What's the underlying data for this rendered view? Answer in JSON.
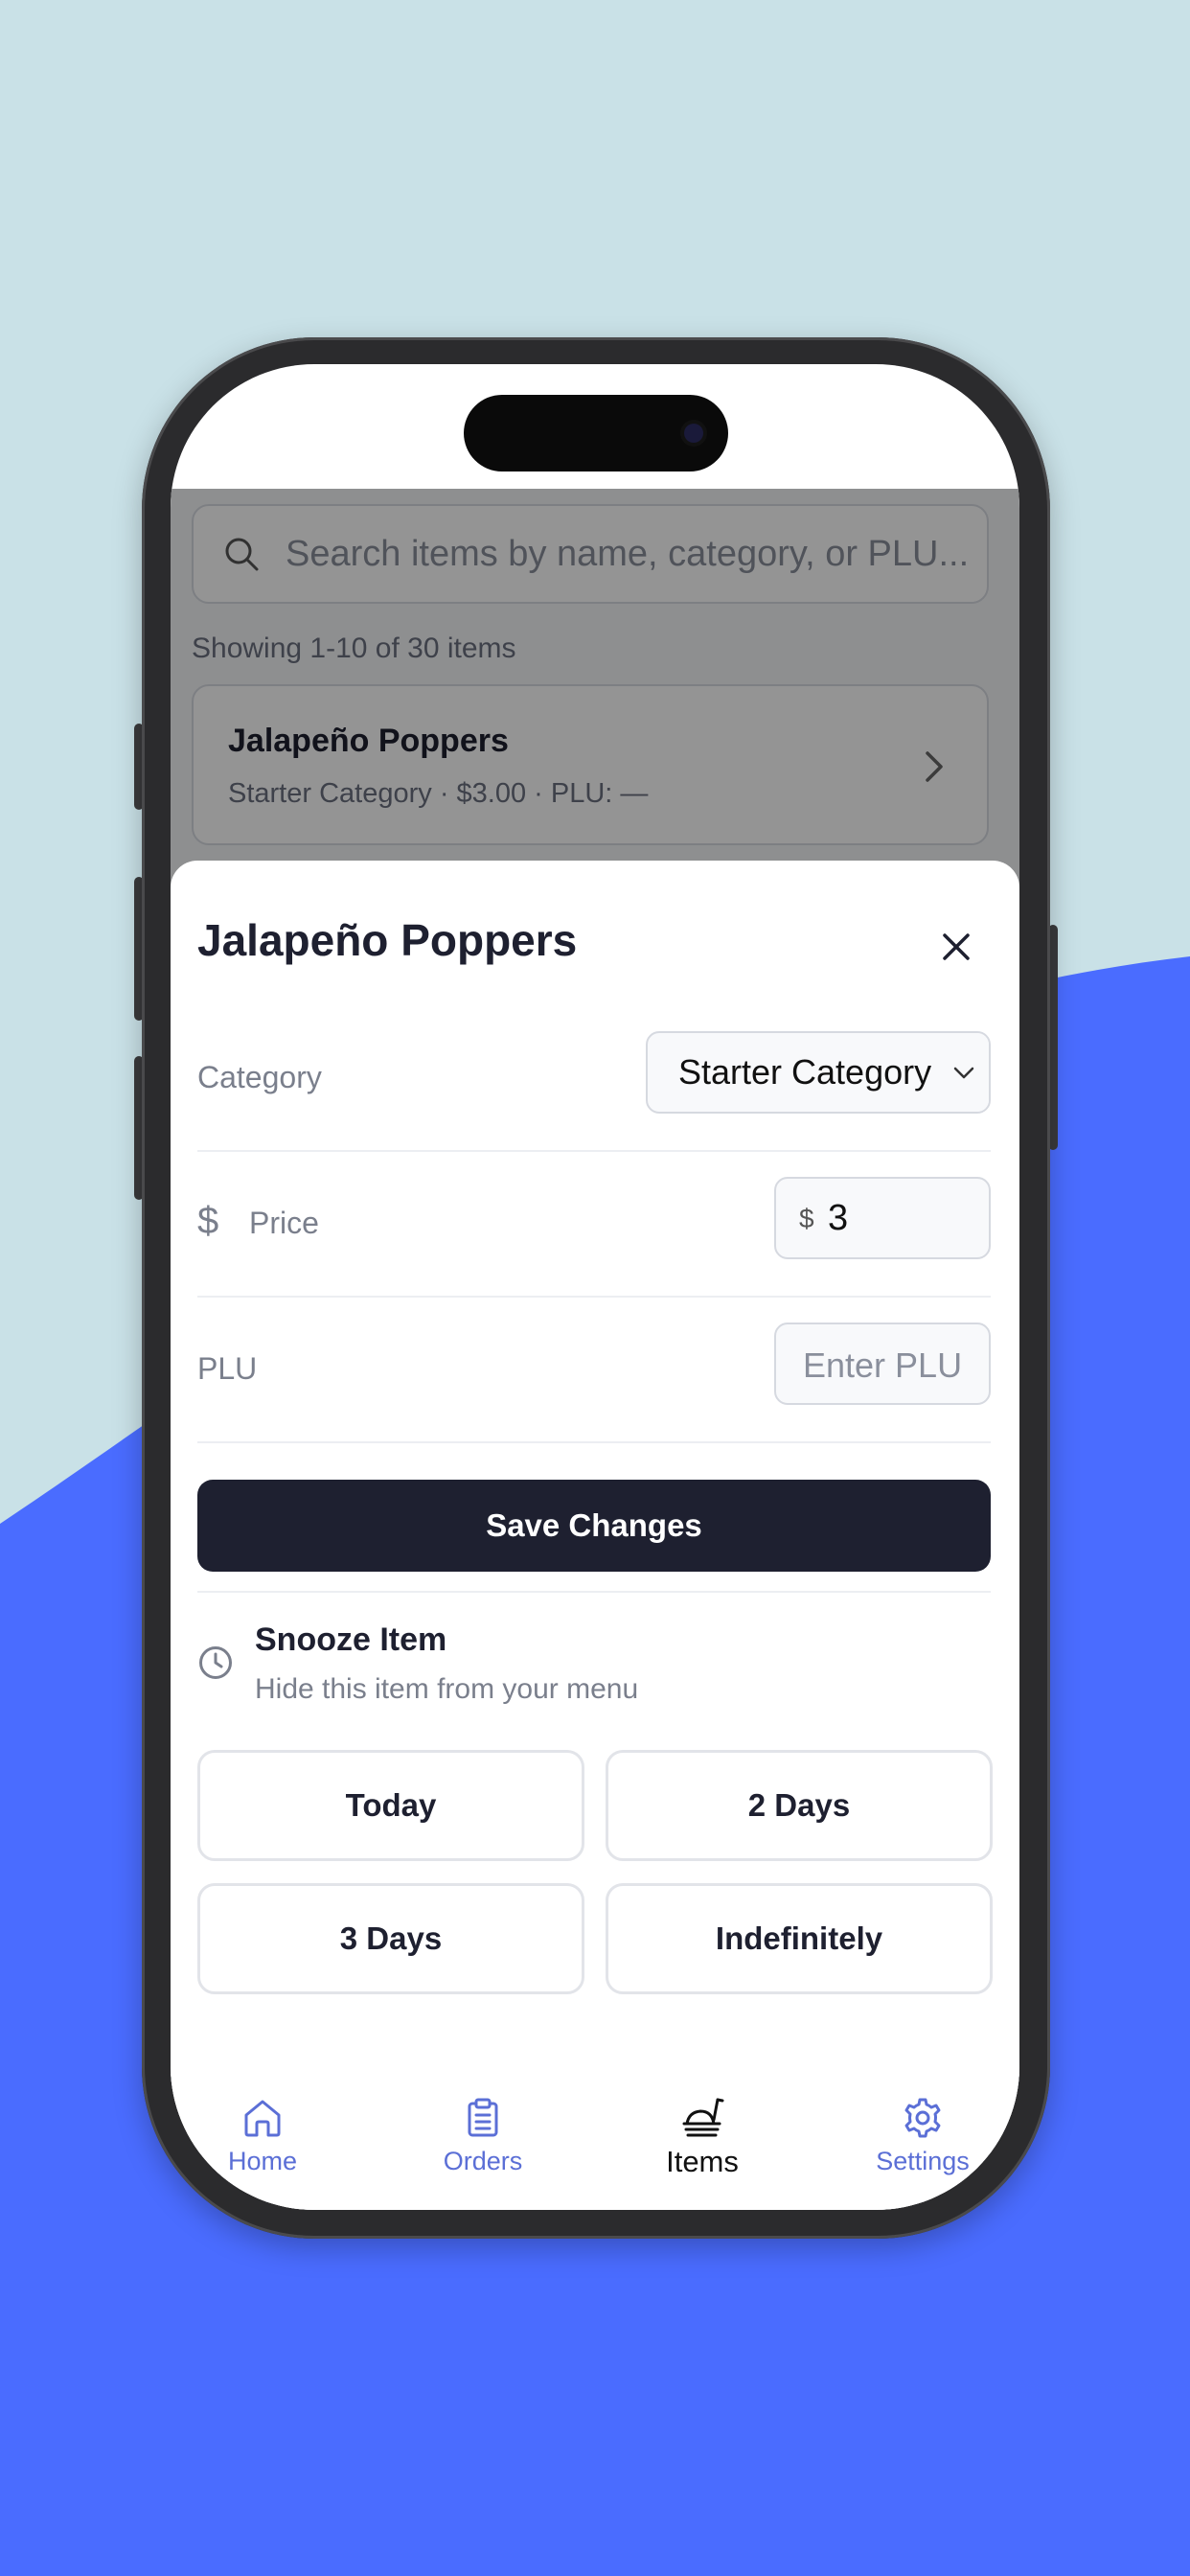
{
  "list_page": {
    "search_placeholder": "Search items by name, category, or PLU...",
    "showing_text": "Showing 1-10 of 30 items",
    "item": {
      "name": "Jalapeño Poppers",
      "meta": "Starter Category · $3.00 · PLU: —"
    }
  },
  "sheet": {
    "title": "Jalapeño Poppers",
    "category": {
      "label": "Category",
      "value": "Starter Category"
    },
    "price": {
      "label": "Price",
      "prefix": "$",
      "value": "3"
    },
    "plu": {
      "label": "PLU",
      "placeholder": "Enter PLU"
    },
    "save_label": "Save Changes",
    "snooze": {
      "title": "Snooze Item",
      "subtitle": "Hide this item from your menu",
      "options": [
        "Today",
        "2 Days",
        "3 Days",
        "Indefinitely"
      ]
    }
  },
  "tabs": [
    {
      "label": "Home",
      "icon": "home-icon"
    },
    {
      "label": "Orders",
      "icon": "clipboard-icon"
    },
    {
      "label": "Items",
      "icon": "food-tray-icon",
      "active": true
    },
    {
      "label": "Settings",
      "icon": "gear-icon"
    }
  ],
  "colors": {
    "background_top": "#c9e1e7",
    "background_wave": "#4a6cff",
    "primary_dark": "#1e2030",
    "tab_inactive": "#5b6fd6"
  }
}
